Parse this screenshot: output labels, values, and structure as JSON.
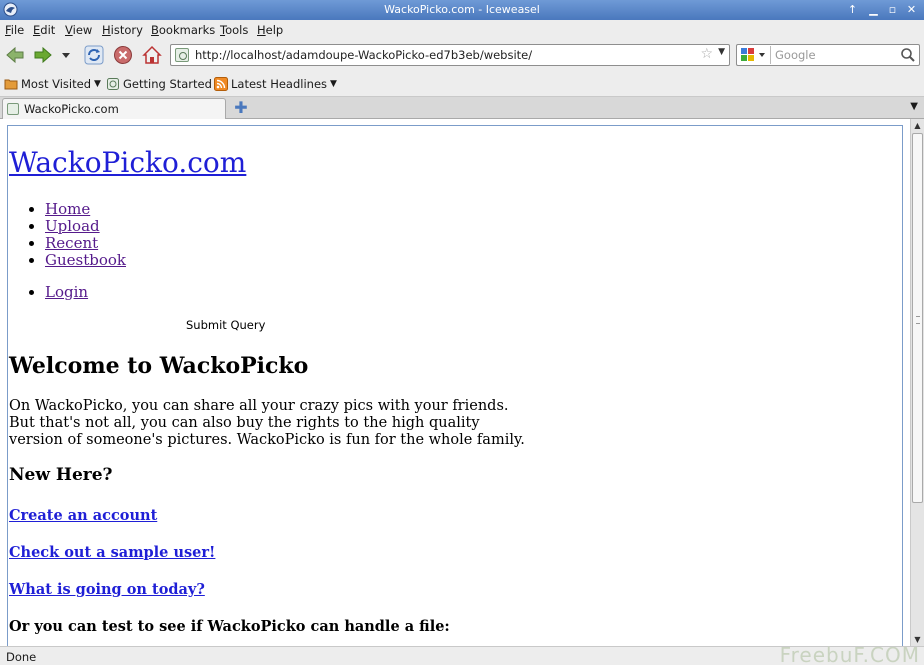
{
  "window": {
    "title": "WackoPicko.com - Iceweasel",
    "buttons": {
      "up": "↑",
      "minimize": "▁",
      "maximize": "▫",
      "close": "✕"
    }
  },
  "menubar": [
    "File",
    "Edit",
    "View",
    "History",
    "Bookmarks",
    "Tools",
    "Help"
  ],
  "navbar": {
    "url": "http://localhost/adamdoupe-WackoPicko-ed7b3eb/website/",
    "search_placeholder": "Google",
    "icons": [
      "back-arrow-icon",
      "forward-arrow-icon",
      "history-dropdown-icon",
      "reload-icon",
      "stop-icon",
      "home-icon",
      "bookmark-star-icon",
      "search-icon"
    ]
  },
  "bookmarks": {
    "most_visited": "Most Visited",
    "getting_started": "Getting Started",
    "latest_headlines": "Latest Headlines"
  },
  "tabs": [
    {
      "label": "WackoPicko.com"
    }
  ],
  "page": {
    "site_title": "WackoPicko.com",
    "nav": [
      "Home",
      "Upload",
      "Recent",
      "Guestbook"
    ],
    "login": "Login",
    "submit_label": "Submit Query",
    "welcome_heading": "Welcome to WackoPicko",
    "intro_lines": [
      "On WackoPicko, you can share all your crazy pics with your friends.",
      "But that's not all, you can also buy the rights to the high quality",
      "version of someone's pictures. WackoPicko is fun for the whole family."
    ],
    "new_here": "New Here?",
    "links": [
      "Create an account",
      "Check out a sample user!",
      "What is going on today?"
    ],
    "file_test": "Or you can test to see if WackoPicko can handle a file:"
  },
  "statusbar": {
    "status": "Done",
    "watermark": "FreebuF.COM"
  },
  "colors": {
    "titlebar": "#4a78bd",
    "link": "#1f1fd6",
    "visited_link": "#551a8b"
  }
}
